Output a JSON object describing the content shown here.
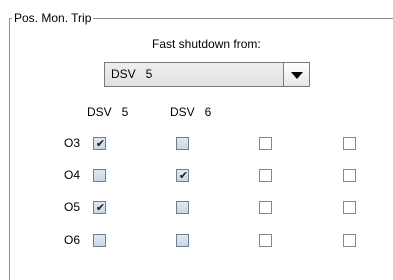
{
  "group": {
    "title": "Pos. Mon. Trip"
  },
  "fast_shutdown": {
    "caption": "Fast shutdown from:",
    "selected": "DSV   5"
  },
  "columns": [
    "DSV   5",
    "DSV   6"
  ],
  "rows": [
    {
      "label": "O3",
      "checks": [
        true,
        false,
        false,
        false
      ]
    },
    {
      "label": "O4",
      "checks": [
        false,
        true,
        false,
        false
      ]
    },
    {
      "label": "O5",
      "checks": [
        true,
        false,
        false,
        false
      ]
    },
    {
      "label": "O6",
      "checks": [
        false,
        false,
        false,
        false
      ]
    }
  ],
  "icons": {
    "dropdown": "chevron-down-icon",
    "check": "checkmark-icon"
  }
}
